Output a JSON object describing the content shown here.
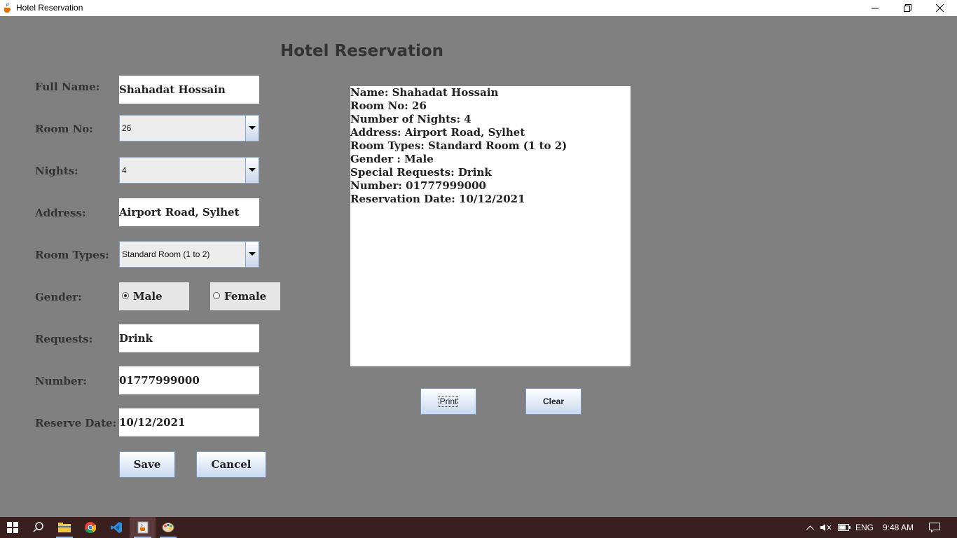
{
  "window": {
    "title": "Hotel Reservation",
    "icon": "java-cup-icon",
    "controls": [
      "minimize-icon",
      "restore-icon",
      "close-icon"
    ]
  },
  "form": {
    "heading": "Hotel Reservation",
    "full_name": {
      "label": "Full Name:",
      "value": "Shahadat Hossain"
    },
    "room_no": {
      "label": "Room No:",
      "value": "26"
    },
    "nights": {
      "label": "Nights:",
      "value": "4"
    },
    "address": {
      "label": "Address:",
      "value": "Airport Road, Sylhet"
    },
    "room_types": {
      "label": "Room Types:",
      "value": "Standard Room (1 to 2)"
    },
    "gender": {
      "label": "Gender:",
      "options": [
        "Male",
        "Female"
      ],
      "selected": "Male"
    },
    "requests": {
      "label": "Requests:",
      "value": "Drink"
    },
    "number": {
      "label": "Number:",
      "value": "01777999000"
    },
    "reserve_date": {
      "label": "Reserve Date:",
      "value": "10/12/2021"
    },
    "save_label": "Save",
    "cancel_label": "Cancel"
  },
  "receipt": {
    "lines": [
      "Name: Shahadat Hossain",
      "Room No: 26",
      "Number of Nights: 4",
      "Address: Airport Road, Sylhet",
      "Room Types: Standard Room (1 to 2)",
      "Gender : Male",
      "Special Requests: Drink",
      "Number: 01777999000",
      "Reservation Date: 10/12/2021"
    ],
    "print_label": "Print",
    "clear_label": "Clear"
  },
  "taskbar": {
    "items": [
      "windows-start-icon",
      "search-icon",
      "file-explorer-icon",
      "chrome-icon",
      "vscode-icon",
      "java-app-icon",
      "paint-app-icon"
    ],
    "tray": {
      "language": "ENG",
      "time": "9:48 AM"
    }
  },
  "colors": {
    "background": "#808080",
    "taskbar": "#3a1f1f",
    "button_gradient_end": "#c9d8ee"
  }
}
